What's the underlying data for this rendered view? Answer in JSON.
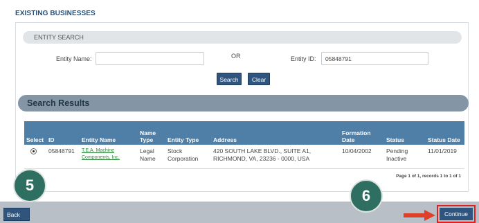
{
  "page_title": "EXISTING BUSINESSES",
  "entity_search": {
    "heading": "ENTITY SEARCH",
    "entity_name_label": "Entity Name:",
    "entity_name_value": "",
    "or_text": "OR",
    "entity_id_label": "Entity ID:",
    "entity_id_value": "05848791",
    "search_label": "Search",
    "clear_label": "Clear"
  },
  "results": {
    "heading": "Search Results",
    "columns": [
      "Select",
      "ID",
      "Entity Name",
      "Name Type",
      "Entity Type",
      "Address",
      "Formation Date",
      "Status",
      "Status Date"
    ],
    "rows": [
      {
        "selected": true,
        "id": "05848791",
        "entity_name": "T.E.A. Machine Components, Inc.",
        "name_type": "Legal Name",
        "entity_type": "Stock Corporation",
        "address": "420 SOUTH LAKE BLVD., SUITE A1, RICHMOND, VA, 23236 - 0000, USA",
        "formation_date": "10/04/2002",
        "status": "Pending Inactive",
        "status_date": "11/01/2019"
      }
    ],
    "pager": "Page 1 of 1, records 1 to 1 of 1"
  },
  "footer": {
    "back_label": "Back",
    "continue_label": "Continue"
  },
  "annotations": {
    "step5": "5",
    "step6": "6"
  },
  "colors": {
    "accent": "#2f557f",
    "header": "#4f7ea7",
    "callout": "#2f6f62",
    "highlight": "#e02020"
  }
}
